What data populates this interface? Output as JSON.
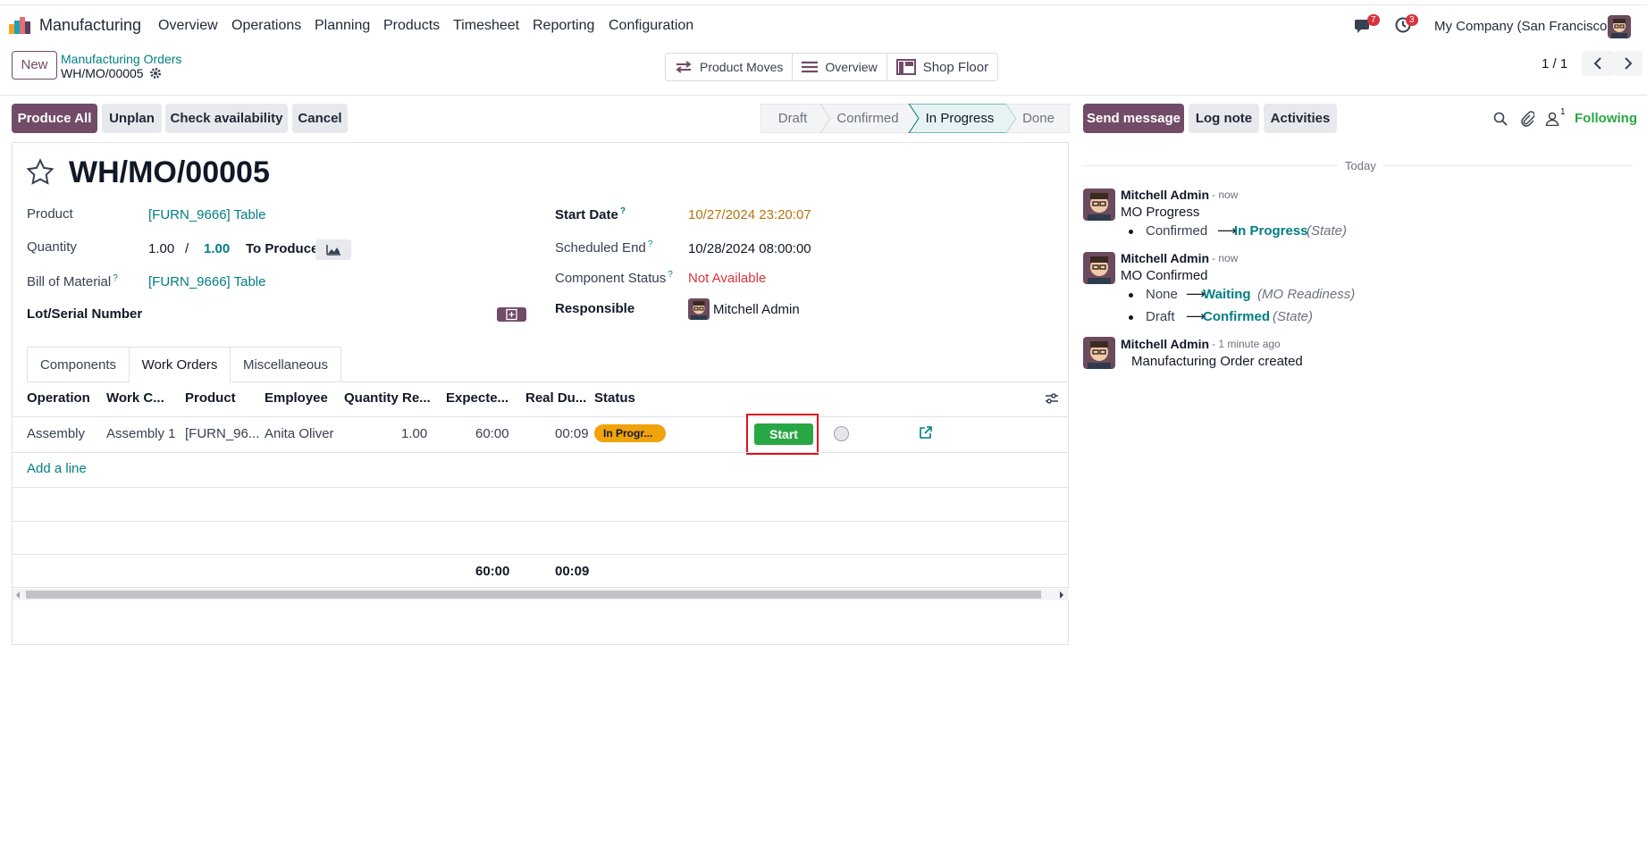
{
  "navbar": {
    "app_name": "Manufacturing",
    "menu": [
      "Overview",
      "Operations",
      "Planning",
      "Products",
      "Timesheet",
      "Reporting",
      "Configuration"
    ],
    "messages_count": "7",
    "activities_count": "3",
    "company": "My Company (San Francisco)"
  },
  "control": {
    "new_label": "New",
    "breadcrumb_parent": "Manufacturing Orders",
    "breadcrumb_current": "WH/MO/00005",
    "smart_buttons": [
      "Product Moves",
      "Overview",
      "Shop Floor"
    ],
    "pager": "1 / 1"
  },
  "actions": {
    "produce_all": "Produce All",
    "unplan": "Unplan",
    "check_availability": "Check availability",
    "cancel": "Cancel"
  },
  "stages": [
    "Draft",
    "Confirmed",
    "In Progress",
    "Done"
  ],
  "current_stage": "In Progress",
  "chatter_actions": {
    "send_message": "Send message",
    "log_note": "Log note",
    "activities": "Activities",
    "followers_count": "1",
    "following": "Following"
  },
  "form": {
    "title": "WH/MO/00005",
    "product_label": "Product",
    "product_value": "[FURN_9666] Table",
    "quantity_label": "Quantity",
    "quantity_value": "1.00",
    "quantity_sep": "/",
    "quantity_target": "1.00",
    "to_produce": "To Produce",
    "bom_label": "Bill of Material",
    "bom_value": "[FURN_9666] Table",
    "lot_label": "Lot/Serial Number",
    "start_date_label": "Start Date",
    "start_date_value": "10/27/2024 23:20:07",
    "scheduled_end_label": "Scheduled End",
    "scheduled_end_value": "10/28/2024 08:00:00",
    "component_status_label": "Component Status",
    "component_status_value": "Not Available",
    "responsible_label": "Responsible",
    "responsible_value": "Mitchell Admin",
    "help_mark": "?"
  },
  "tabs": [
    "Components",
    "Work Orders",
    "Miscellaneous"
  ],
  "active_tab": "Work Orders",
  "workorders": {
    "columns": [
      "Operation",
      "Work C...",
      "Product",
      "Employee",
      "Quantity Re...",
      "Expecte...",
      "Real Du...",
      "Status"
    ],
    "row": {
      "operation": "Assembly",
      "work_center": "Assembly 1",
      "product": "[FURN_96...",
      "employee": "Anita Oliver",
      "quantity": "1.00",
      "expected": "60:00",
      "real": "00:09",
      "status": "In Progr...",
      "start_button": "Start"
    },
    "add_line": "Add a line",
    "total_expected": "60:00",
    "total_real": "00:09"
  },
  "chatter": {
    "date_separator": "Today",
    "messages": [
      {
        "author": "Mitchell Admin",
        "time": "- now",
        "title": "MO Progress",
        "changes": [
          {
            "old": "Confirmed",
            "new": "In Progress",
            "field": "(State)"
          }
        ]
      },
      {
        "author": "Mitchell Admin",
        "time": "- now",
        "title": "MO Confirmed",
        "changes": [
          {
            "old": "None",
            "new": "Waiting",
            "field": "(MO Readiness)"
          },
          {
            "old": "Draft",
            "new": "Confirmed",
            "field": "(State)"
          }
        ]
      },
      {
        "author": "Mitchell Admin",
        "time": "- 1 minute ago",
        "body": "Manufacturing Order created"
      }
    ]
  },
  "colors": {
    "primary": "#714b67",
    "link": "#017e84",
    "start_green": "#28a745",
    "status_orange": "#f0a30a",
    "danger": "#d9333f",
    "highlight_box": "#e0101b"
  }
}
